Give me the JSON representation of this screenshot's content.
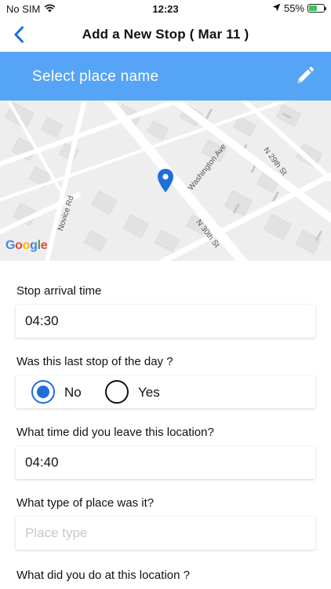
{
  "status": {
    "carrier": "No SIM",
    "time": "12:23",
    "battery": "55%",
    "battery_level": 0.55
  },
  "nav": {
    "title": "Add a New Stop  ( Mar 11 )",
    "back_icon": "chevron-left-icon"
  },
  "place": {
    "label": "Select place name",
    "edit_icon": "pencil-icon",
    "bar_color": "#56a4f5"
  },
  "map": {
    "streets": [
      "Washington Ave",
      "N 29th St",
      "N 30th St",
      "Novice Rd"
    ],
    "logo": "Google",
    "pin_color": "#1e6fd9"
  },
  "form": {
    "arrival": {
      "label": "Stop arrival time",
      "value": "04:30"
    },
    "last_stop": {
      "label": "Was this last stop of the day ?",
      "options": [
        "No",
        "Yes"
      ],
      "selected": "No"
    },
    "leave": {
      "label": "What time did you leave this location?",
      "value": "04:40"
    },
    "place_type": {
      "label": "What type of place was it?",
      "placeholder": "Place type"
    },
    "activity": {
      "label": "What did you do at this location ?"
    }
  },
  "colors": {
    "accent": "#1e6fd9"
  }
}
